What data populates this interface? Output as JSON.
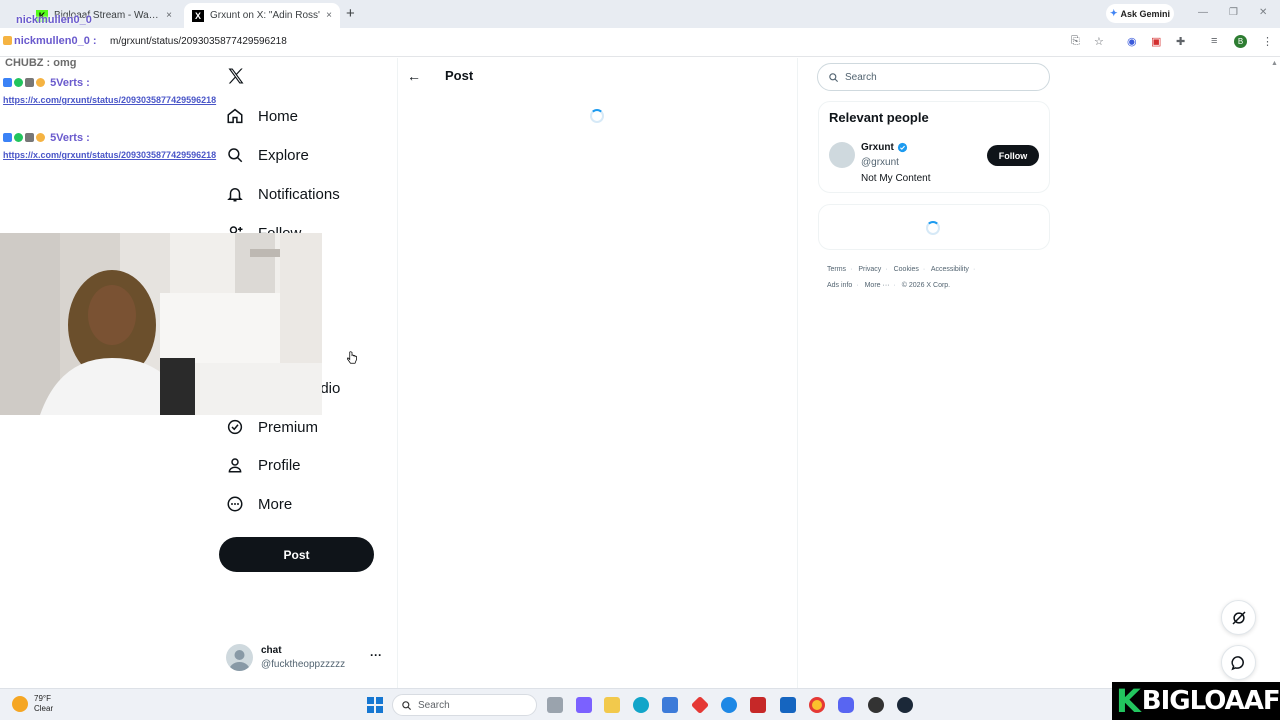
{
  "browser": {
    "tabs": [
      {
        "title": "Bigloaaf Stream - Watch Live on",
        "close": "×",
        "favicon": "K"
      },
      {
        "title": "Grxunt on X: \"Adin Ross's friend",
        "close": "×",
        "favicon": "X"
      }
    ],
    "new_tab": "+",
    "ask_gemini": "Ask Gemini",
    "url": "m/grxunt/status/2093035877429596218",
    "profile_initial": "B"
  },
  "chat_overlay": {
    "top_user": "nickmullen0_0",
    "line1_user": "nickmullen0_0 :",
    "line2": "CHUBZ : omg",
    "msg1_user": "5Verts :",
    "msg1_link": "https://x.com/grxunt/status/2093035877429596218",
    "msg2_user": "5Verts :",
    "msg2_link": "https://x.com/grxunt/status/2093035877429596218"
  },
  "nav": {
    "items": [
      {
        "label": "Home",
        "icon": "home-icon"
      },
      {
        "label": "Explore",
        "icon": "search-icon"
      },
      {
        "label": "Notifications",
        "icon": "bell-icon"
      },
      {
        "label": "Follow",
        "icon": "person-plus-icon"
      },
      {
        "label": "udio",
        "icon": ""
      },
      {
        "label": "Premium",
        "icon": "verified-icon"
      },
      {
        "label": "Profile",
        "icon": "person-icon"
      },
      {
        "label": "More",
        "icon": "more-circle-icon"
      }
    ],
    "post_button": "Post",
    "account": {
      "name": "chat",
      "handle": "@fucktheoppzzzzz",
      "more": "···"
    }
  },
  "center": {
    "title": "Post",
    "back": "←"
  },
  "right": {
    "search_placeholder": "Search",
    "relevant_title": "Relevant people",
    "person": {
      "name": "Grxunt",
      "handle": "@grxunt",
      "bio": "Not My Content",
      "follow": "Follow"
    },
    "footer": [
      "Terms",
      "Privacy",
      "Cookies",
      "Accessibility",
      "Ads info",
      "More ···",
      "© 2026 X Corp."
    ]
  },
  "taskbar": {
    "temperature": "79°F",
    "weather": "Clear",
    "search_placeholder": "Search"
  },
  "watermark": {
    "k": "K",
    "text": "BIGLOAAF"
  },
  "colors": {
    "x_blue": "#1d9bf0",
    "text": "#0f1419",
    "muted": "#536471",
    "overlay_link": "#4a56c8"
  }
}
